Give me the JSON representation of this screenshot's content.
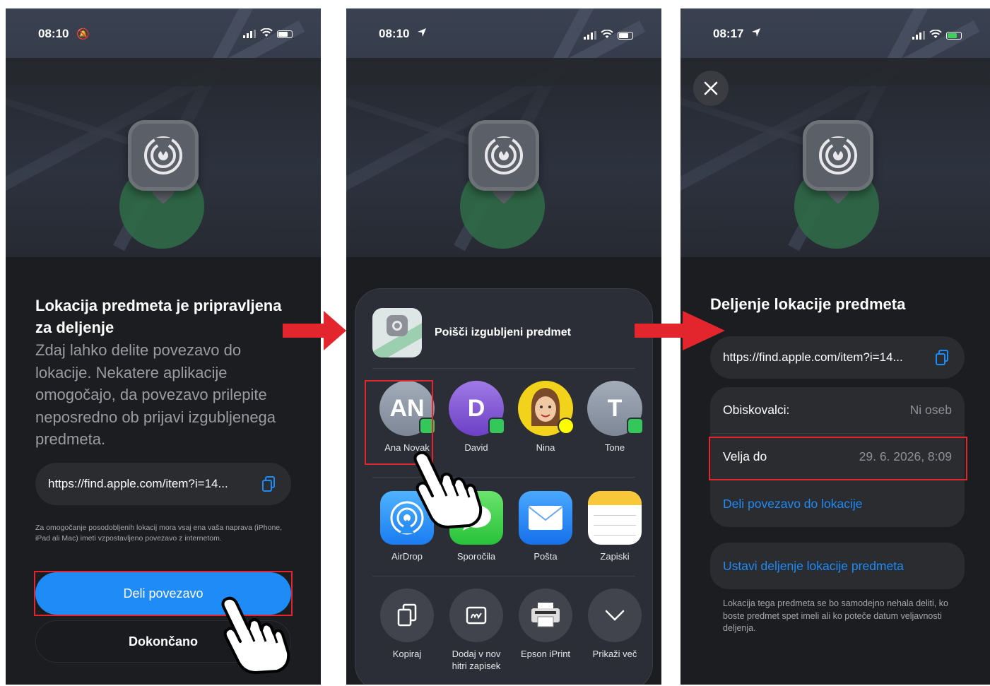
{
  "screens": [
    {
      "status": {
        "time": "08:10"
      },
      "title": "Lokacija predmeta je pripravljena za deljenje",
      "body": "Zdaj lahko delite povezavo do lokacije. Nekatere aplikacije omogočajo, da povezavo prilepite neposredno ob prijavi izgubljenega predmeta.",
      "link": "https://find.apple.com/item?i=14...",
      "note": "Za omogočanje posodobljenih lokacij mora vsaj ena vaša naprava (iPhone, iPad ali Mac) imeti vzpostavljeno povezavo z internetom.",
      "primary_button": "Deli povezavo",
      "secondary_button": "Dokončano"
    },
    {
      "status": {
        "time": "08:10"
      },
      "share_title": "Poišči izgubljeni predmet",
      "contacts": [
        {
          "initials": "AN",
          "name": "Ana Novak",
          "color": "#8e9aa8"
        },
        {
          "initials": "D",
          "name": "David",
          "color": "#8a5cd6"
        },
        {
          "initials": "",
          "name": "Nina",
          "color": "#f2d21b"
        },
        {
          "initials": "T",
          "name": "Tone",
          "color": "#8e9aa8"
        }
      ],
      "apps": [
        {
          "name": "AirDrop",
          "icon": "airdrop-icon"
        },
        {
          "name": "Sporočila",
          "icon": "messages-icon"
        },
        {
          "name": "Pošta",
          "icon": "mail-icon"
        },
        {
          "name": "Zapiski",
          "icon": "notes-icon"
        }
      ],
      "actions": [
        {
          "name": "Kopiraj",
          "icon": "copy-icon"
        },
        {
          "name": "Dodaj v nov hitri zapisek",
          "icon": "quick-note-icon"
        },
        {
          "name": "Epson iPrint",
          "icon": "printer-icon"
        },
        {
          "name": "Prikaži več",
          "icon": "chevron-down-icon"
        }
      ]
    },
    {
      "status": {
        "time": "08:17"
      },
      "title": "Deljenje lokacije predmeta",
      "link": "https://find.apple.com/item?i=14...",
      "rows": [
        {
          "label": "Obiskovalci:",
          "value": "Ni oseb"
        },
        {
          "label": "Velja do",
          "value": "29. 6. 2026, 8:09"
        }
      ],
      "share_link_label": "Deli povezavo do lokacije",
      "stop_label": "Ustavi deljenje lokacije predmeta",
      "note": "Lokacija tega predmeta se bo samodejno nehala deliti, ko boste predmet spet imeli ali ko poteče datum veljavnosti deljenja."
    }
  ],
  "colors": {
    "accent": "#1e8bf6",
    "highlight": "#e3262d",
    "arrow": "#e3262d"
  }
}
